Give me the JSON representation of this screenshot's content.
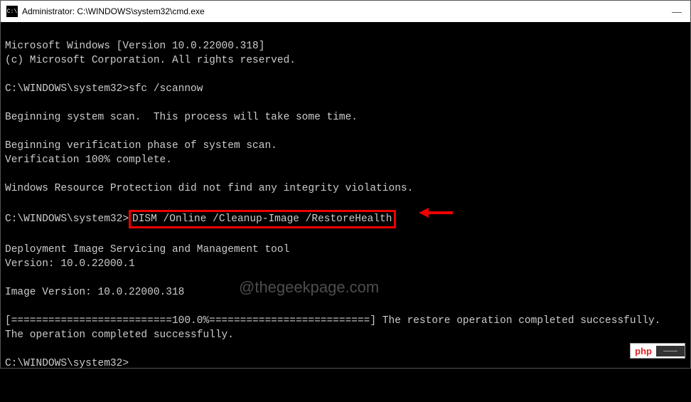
{
  "window": {
    "title": "Administrator: C:\\WINDOWS\\system32\\cmd.exe",
    "icon_label": "C:\\"
  },
  "lines": {
    "l1": "Microsoft Windows [Version 10.0.22000.318]",
    "l2": "(c) Microsoft Corporation. All rights reserved.",
    "prompt1": "C:\\WINDOWS\\system32>",
    "cmd1": "sfc /scannow",
    "l3": "Beginning system scan.  This process will take some time.",
    "l4": "Beginning verification phase of system scan.",
    "l5": "Verification 100% complete.",
    "l6": "Windows Resource Protection did not find any integrity violations.",
    "prompt2": "C:\\WINDOWS\\system32>",
    "cmd2": "DISM /Online /Cleanup-Image /RestoreHealth",
    "l7": "Deployment Image Servicing and Management tool",
    "l8": "Version: 10.0.22000.1",
    "l9": "Image Version: 10.0.22000.318",
    "l10": "[==========================100.0%==========================] The restore operation completed successfully.",
    "l11": "The operation completed successfully.",
    "prompt3": "C:\\WINDOWS\\system32>"
  },
  "watermark": "@thegeekpage.com",
  "badge": {
    "left": "php",
    "right": "——"
  }
}
